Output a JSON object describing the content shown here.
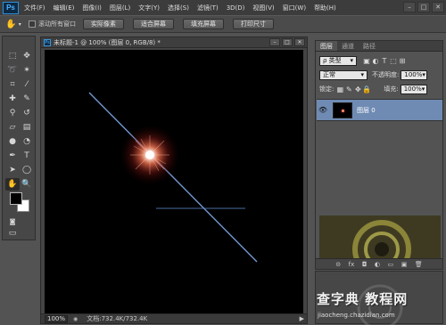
{
  "app": {
    "logo": "Ps"
  },
  "menu": [
    "文件(F)",
    "编辑(E)",
    "图像(I)",
    "图层(L)",
    "文字(Y)",
    "选择(S)",
    "滤镜(T)",
    "3D(D)",
    "视图(V)",
    "窗口(W)",
    "帮助(H)"
  ],
  "window_controls": {
    "minimize": "–",
    "maximize": "□",
    "close": "✕"
  },
  "options_bar": {
    "scroll_all_label": "滚动所有窗口",
    "buttons": [
      "实际像素",
      "适合屏幕",
      "填充屏幕",
      "打印尺寸"
    ]
  },
  "document": {
    "title": "未标题-1 @ 100% (图层 0, RGB/8) *",
    "zoom": "100%",
    "doc_info": "文档:732.4K/732.4K"
  },
  "layers_panel": {
    "tabs": [
      "图层",
      "通道",
      "路径"
    ],
    "kind_filter": "ρ 类型",
    "blend_mode": "正常",
    "opacity_label": "不透明度:",
    "opacity_value": "100%",
    "lock_label": "锁定:",
    "fill_label": "填充:",
    "fill_value": "100%",
    "layers": [
      {
        "name": "图层 0",
        "visible": true
      }
    ],
    "footer_icons": [
      "link-icon",
      "fx-icon",
      "mask-icon",
      "adjustment-icon",
      "group-icon",
      "new-layer-icon",
      "trash-icon"
    ],
    "footer_glyphs": [
      "⊝",
      "fx",
      "◘",
      "◐",
      "▭",
      "▣",
      "🗑"
    ]
  },
  "colors": {
    "foreground": "#000000",
    "background": "#ffffff",
    "selected_layer": "#6f8bb3",
    "canvas": "#000000"
  },
  "watermark": {
    "text": "查字典 教程网",
    "url": "jiaocheng.chazidian.com"
  }
}
